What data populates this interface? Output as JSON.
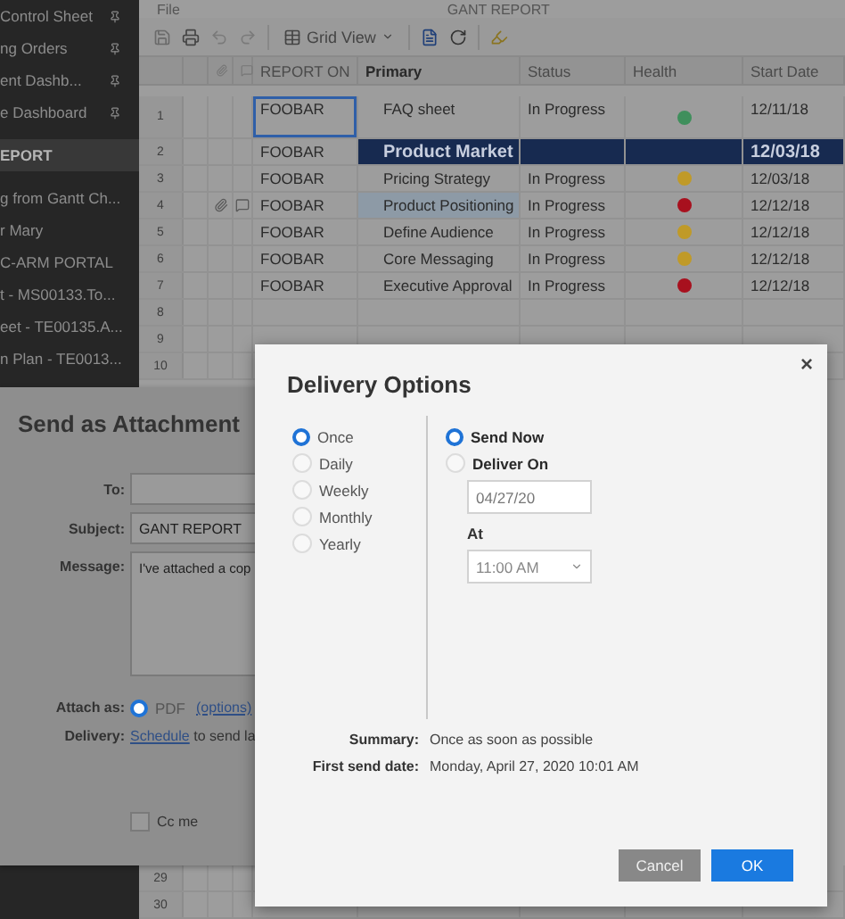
{
  "sidebar": {
    "items": [
      {
        "label": "Control Sheet",
        "pinned": true,
        "selected": false
      },
      {
        "label": "ng Orders",
        "pinned": true,
        "selected": false
      },
      {
        "label": "ent Dashb...",
        "pinned": true,
        "selected": false
      },
      {
        "label": "e Dashboard",
        "pinned": true,
        "selected": false
      },
      {
        "label": "EPORT",
        "pinned": false,
        "selected": true
      },
      {
        "label": "g from Gantt Ch...",
        "pinned": false,
        "selected": false
      },
      {
        "label": "r Mary",
        "pinned": false,
        "selected": false
      },
      {
        "label": "C-ARM PORTAL",
        "pinned": false,
        "selected": false
      },
      {
        "label": "t - MS00133.To...",
        "pinned": false,
        "selected": false
      },
      {
        "label": "eet - TE00135.A...",
        "pinned": false,
        "selected": false
      },
      {
        "label": "n Plan - TE0013...",
        "pinned": false,
        "selected": false
      }
    ]
  },
  "menu": {
    "label": "File"
  },
  "sheet_title": "GANT REPORT",
  "toolbar": {
    "view": "Grid View"
  },
  "grid": {
    "columns": [
      "REPORT ON",
      "Primary",
      "Status",
      "Health",
      "Start Date"
    ],
    "rows": [
      {
        "number": "1",
        "kind": "task",
        "selected": true,
        "highlighted": false,
        "attachment": false,
        "comment": false,
        "report_on": "FOOBAR",
        "primary": "FAQ sheet",
        "status": "In Progress",
        "color": "#3f8f5c",
        "start_date": "12/11/18"
      },
      {
        "number": "2",
        "kind": "section",
        "selected": false,
        "highlighted": false,
        "attachment": false,
        "comment": false,
        "report_on": "FOOBAR",
        "primary": "Product Market",
        "start_date": "12/03/18"
      },
      {
        "number": "3",
        "kind": "task",
        "selected": false,
        "highlighted": false,
        "attachment": false,
        "comment": false,
        "report_on": "FOOBAR",
        "primary": "Pricing Strategy",
        "status": "In Progress",
        "color": "#c09a28",
        "start_date": "12/03/18"
      },
      {
        "number": "4",
        "kind": "task",
        "selected": false,
        "highlighted": true,
        "attachment": true,
        "comment": true,
        "report_on": "FOOBAR",
        "primary": "Product Positioning",
        "status": "In Progress",
        "color": "#a8101e",
        "start_date": "12/12/18"
      },
      {
        "number": "5",
        "kind": "task",
        "selected": false,
        "highlighted": false,
        "attachment": false,
        "comment": false,
        "report_on": "FOOBAR",
        "primary": "Define Audience",
        "status": "In Progress",
        "color": "#c09a28",
        "start_date": "12/12/18"
      },
      {
        "number": "6",
        "kind": "task",
        "selected": false,
        "highlighted": false,
        "attachment": false,
        "comment": false,
        "report_on": "FOOBAR",
        "primary": "Core Messaging",
        "status": "In Progress",
        "color": "#c09a28",
        "start_date": "12/12/18"
      },
      {
        "number": "7",
        "kind": "task",
        "selected": false,
        "highlighted": false,
        "attachment": false,
        "comment": false,
        "report_on": "FOOBAR",
        "primary": "Executive Approval",
        "status": "In Progress",
        "color": "#a8101e",
        "start_date": "12/12/18"
      },
      {
        "number": "8",
        "kind": "blank",
        "selected": false,
        "highlighted": false,
        "attachment": false,
        "comment": false
      },
      {
        "number": "9",
        "kind": "blank",
        "selected": false,
        "highlighted": false,
        "attachment": false,
        "comment": false
      },
      {
        "number": "10",
        "kind": "blank",
        "attachment": false,
        "comment": false
      }
    ],
    "lower_rows": [
      "29",
      "30"
    ]
  },
  "send_dialog": {
    "title": "Send as Attachment",
    "to": {
      "label": "To:"
    },
    "subject": {
      "label": "Subject:",
      "value": "GANT REPORT"
    },
    "message": {
      "label": "Message:",
      "value": "I've attached a cop"
    },
    "attach": {
      "label": "Attach as:",
      "option": "PDF",
      "selected": true,
      "link": "(options)"
    },
    "delivery": {
      "label": "Delivery:",
      "link": "Schedule",
      "text": "to send la"
    },
    "cc": {
      "label": "Cc me",
      "checked": false
    }
  },
  "delivery_dialog": {
    "title": "Delivery Options",
    "close": "×",
    "frequency": [
      {
        "label": "Once",
        "selected": true
      },
      {
        "label": "Daily",
        "selected": false
      },
      {
        "label": "Weekly",
        "selected": false
      },
      {
        "label": "Monthly",
        "selected": false
      },
      {
        "label": "Yearly",
        "selected": false
      }
    ],
    "timing": [
      {
        "label": "Send Now",
        "selected": true
      },
      {
        "label": "Deliver On",
        "selected": false
      }
    ],
    "date": "04/27/20",
    "time_label": "At",
    "time": "11:00 AM",
    "summary": {
      "label": "Summary:",
      "value": "Once as soon as possible"
    },
    "first_send": {
      "label": "First send date:",
      "value": "Monday, April 27, 2020 10:01 AM"
    },
    "buttons": [
      {
        "label": "Cancel",
        "kind": "secondary"
      },
      {
        "label": "OK",
        "kind": "primary"
      }
    ]
  }
}
